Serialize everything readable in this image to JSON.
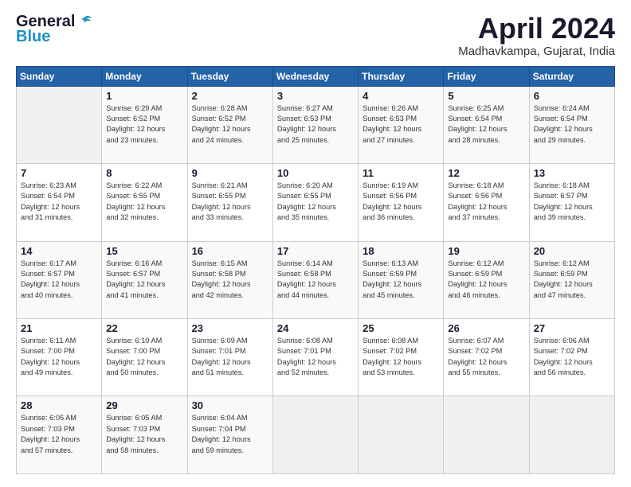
{
  "logo": {
    "line1": "General",
    "line2": "Blue"
  },
  "title": "April 2024",
  "location": "Madhavkampa, Gujarat, India",
  "days_header": [
    "Sunday",
    "Monday",
    "Tuesday",
    "Wednesday",
    "Thursday",
    "Friday",
    "Saturday"
  ],
  "weeks": [
    [
      {
        "day": "",
        "info": ""
      },
      {
        "day": "1",
        "info": "Sunrise: 6:29 AM\nSunset: 6:52 PM\nDaylight: 12 hours\nand 23 minutes."
      },
      {
        "day": "2",
        "info": "Sunrise: 6:28 AM\nSunset: 6:52 PM\nDaylight: 12 hours\nand 24 minutes."
      },
      {
        "day": "3",
        "info": "Sunrise: 6:27 AM\nSunset: 6:53 PM\nDaylight: 12 hours\nand 25 minutes."
      },
      {
        "day": "4",
        "info": "Sunrise: 6:26 AM\nSunset: 6:53 PM\nDaylight: 12 hours\nand 27 minutes."
      },
      {
        "day": "5",
        "info": "Sunrise: 6:25 AM\nSunset: 6:54 PM\nDaylight: 12 hours\nand 28 minutes."
      },
      {
        "day": "6",
        "info": "Sunrise: 6:24 AM\nSunset: 6:54 PM\nDaylight: 12 hours\nand 29 minutes."
      }
    ],
    [
      {
        "day": "7",
        "info": "Sunrise: 6:23 AM\nSunset: 6:54 PM\nDaylight: 12 hours\nand 31 minutes."
      },
      {
        "day": "8",
        "info": "Sunrise: 6:22 AM\nSunset: 6:55 PM\nDaylight: 12 hours\nand 32 minutes."
      },
      {
        "day": "9",
        "info": "Sunrise: 6:21 AM\nSunset: 6:55 PM\nDaylight: 12 hours\nand 33 minutes."
      },
      {
        "day": "10",
        "info": "Sunrise: 6:20 AM\nSunset: 6:55 PM\nDaylight: 12 hours\nand 35 minutes."
      },
      {
        "day": "11",
        "info": "Sunrise: 6:19 AM\nSunset: 6:56 PM\nDaylight: 12 hours\nand 36 minutes."
      },
      {
        "day": "12",
        "info": "Sunrise: 6:18 AM\nSunset: 6:56 PM\nDaylight: 12 hours\nand 37 minutes."
      },
      {
        "day": "13",
        "info": "Sunrise: 6:18 AM\nSunset: 6:57 PM\nDaylight: 12 hours\nand 39 minutes."
      }
    ],
    [
      {
        "day": "14",
        "info": "Sunrise: 6:17 AM\nSunset: 6:57 PM\nDaylight: 12 hours\nand 40 minutes."
      },
      {
        "day": "15",
        "info": "Sunrise: 6:16 AM\nSunset: 6:57 PM\nDaylight: 12 hours\nand 41 minutes."
      },
      {
        "day": "16",
        "info": "Sunrise: 6:15 AM\nSunset: 6:58 PM\nDaylight: 12 hours\nand 42 minutes."
      },
      {
        "day": "17",
        "info": "Sunrise: 6:14 AM\nSunset: 6:58 PM\nDaylight: 12 hours\nand 44 minutes."
      },
      {
        "day": "18",
        "info": "Sunrise: 6:13 AM\nSunset: 6:59 PM\nDaylight: 12 hours\nand 45 minutes."
      },
      {
        "day": "19",
        "info": "Sunrise: 6:12 AM\nSunset: 6:59 PM\nDaylight: 12 hours\nand 46 minutes."
      },
      {
        "day": "20",
        "info": "Sunrise: 6:12 AM\nSunset: 6:59 PM\nDaylight: 12 hours\nand 47 minutes."
      }
    ],
    [
      {
        "day": "21",
        "info": "Sunrise: 6:11 AM\nSunset: 7:00 PM\nDaylight: 12 hours\nand 49 minutes."
      },
      {
        "day": "22",
        "info": "Sunrise: 6:10 AM\nSunset: 7:00 PM\nDaylight: 12 hours\nand 50 minutes."
      },
      {
        "day": "23",
        "info": "Sunrise: 6:09 AM\nSunset: 7:01 PM\nDaylight: 12 hours\nand 51 minutes."
      },
      {
        "day": "24",
        "info": "Sunrise: 6:08 AM\nSunset: 7:01 PM\nDaylight: 12 hours\nand 52 minutes."
      },
      {
        "day": "25",
        "info": "Sunrise: 6:08 AM\nSunset: 7:02 PM\nDaylight: 12 hours\nand 53 minutes."
      },
      {
        "day": "26",
        "info": "Sunrise: 6:07 AM\nSunset: 7:02 PM\nDaylight: 12 hours\nand 55 minutes."
      },
      {
        "day": "27",
        "info": "Sunrise: 6:06 AM\nSunset: 7:02 PM\nDaylight: 12 hours\nand 56 minutes."
      }
    ],
    [
      {
        "day": "28",
        "info": "Sunrise: 6:05 AM\nSunset: 7:03 PM\nDaylight: 12 hours\nand 57 minutes."
      },
      {
        "day": "29",
        "info": "Sunrise: 6:05 AM\nSunset: 7:03 PM\nDaylight: 12 hours\nand 58 minutes."
      },
      {
        "day": "30",
        "info": "Sunrise: 6:04 AM\nSunset: 7:04 PM\nDaylight: 12 hours\nand 59 minutes."
      },
      {
        "day": "",
        "info": ""
      },
      {
        "day": "",
        "info": ""
      },
      {
        "day": "",
        "info": ""
      },
      {
        "day": "",
        "info": ""
      }
    ]
  ]
}
